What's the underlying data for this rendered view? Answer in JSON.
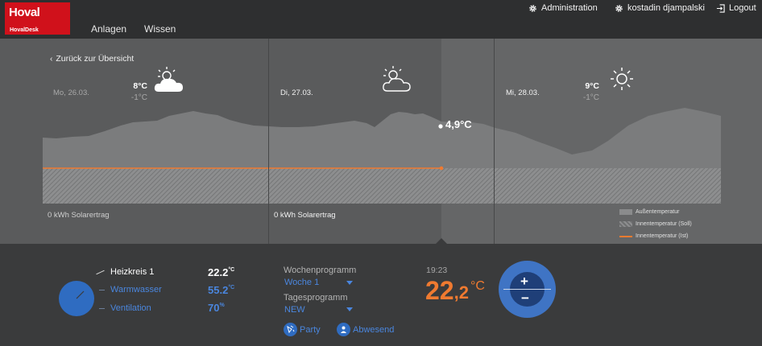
{
  "brand": {
    "name": "Hoval",
    "product": "HovalDesk",
    "color": "#d0111b"
  },
  "nav": {
    "items": [
      "Anlagen",
      "Wissen"
    ]
  },
  "user_menu": {
    "administration": "Administration",
    "user": "kostadin djampalski",
    "logout": "Logout"
  },
  "weather": {
    "back_label": "Zurück zur Übersicht",
    "days": [
      {
        "label": "Mo, 26.03.",
        "max": "8°C",
        "min": "-1°C",
        "icon": "cloudy-sun-icon",
        "solar": "0 kWh Solarertrag"
      },
      {
        "label": "Di, 27.03.",
        "max": "",
        "min": "",
        "icon": "partly-cloudy-icon",
        "solar": "0 kWh Solarertrag"
      },
      {
        "label": "Mi, 28.03.",
        "max": "9°C",
        "min": "-1°C",
        "icon": "sun-icon",
        "solar": ""
      }
    ],
    "current_temp": "4,9°C",
    "legend": [
      "Außentemperatur",
      "Innentemperatur (Soll)",
      "Innentemperatur (Ist)"
    ],
    "colors": {
      "outdoor": "#7b7c7d",
      "actual": "#f07a30"
    }
  },
  "controls": {
    "circuits": [
      {
        "label": "Heizkreis 1",
        "value": "22.2",
        "unit": "°C",
        "active": true
      },
      {
        "label": "Warmwasser",
        "value": "55.2",
        "unit": "°C",
        "active": false
      },
      {
        "label": "Ventilation",
        "value": "70",
        "unit": "%",
        "active": false
      }
    ],
    "week_program_label": "Wochenprogramm",
    "week_program_value": "Woche 1",
    "day_program_label": "Tagesprogramm",
    "day_program_value": "NEW",
    "party_label": "Party",
    "away_label": "Abwesend",
    "time": "19:23",
    "temp_int": "22",
    "temp_dec": ",2",
    "temp_unit": "°C",
    "accent": "#2f6cc1",
    "temp_color": "#f07a30"
  }
}
